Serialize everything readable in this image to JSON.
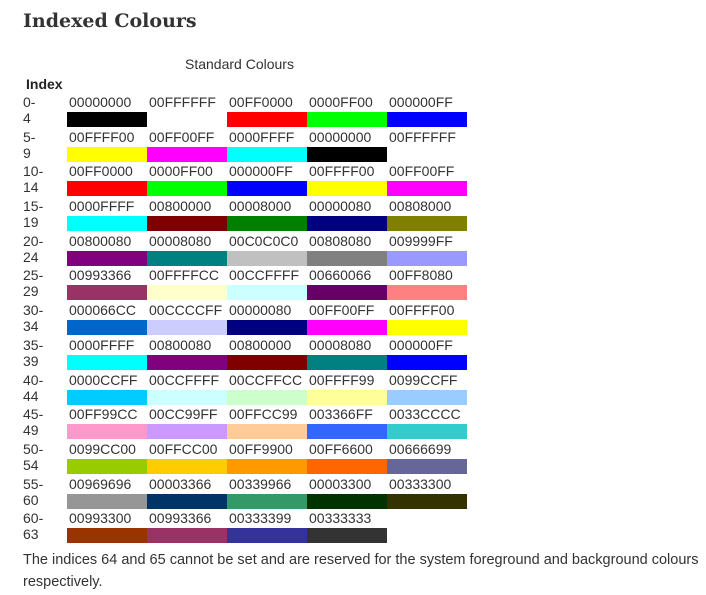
{
  "title": "Indexed Colours",
  "caption": "Standard Colours",
  "index_header": "Index",
  "rows": [
    {
      "label": "0-4",
      "colors": [
        "00000000",
        "00FFFFFF",
        "00FF0000",
        "0000FF00",
        "000000FF"
      ]
    },
    {
      "label": "5-9",
      "colors": [
        "00FFFF00",
        "00FF00FF",
        "0000FFFF",
        "00000000",
        "00FFFFFF"
      ]
    },
    {
      "label": "10-14",
      "colors": [
        "00FF0000",
        "0000FF00",
        "000000FF",
        "00FFFF00",
        "00FF00FF"
      ]
    },
    {
      "label": "15-19",
      "colors": [
        "0000FFFF",
        "00800000",
        "00008000",
        "00000080",
        "00808000"
      ]
    },
    {
      "label": "20-24",
      "colors": [
        "00800080",
        "00008080",
        "00C0C0C0",
        "00808080",
        "009999FF"
      ]
    },
    {
      "label": "25-29",
      "colors": [
        "00993366",
        "00FFFFCC",
        "00CCFFFF",
        "00660066",
        "00FF8080"
      ]
    },
    {
      "label": "30-34",
      "colors": [
        "000066CC",
        "00CCCCFF",
        "00000080",
        "00FF00FF",
        "00FFFF00"
      ]
    },
    {
      "label": "35-39",
      "colors": [
        "0000FFFF",
        "00800080",
        "00800000",
        "00008080",
        "000000FF"
      ]
    },
    {
      "label": "40-44",
      "colors": [
        "0000CCFF",
        "00CCFFFF",
        "00CCFFCC",
        "00FFFF99",
        "0099CCFF"
      ]
    },
    {
      "label": "45-49",
      "colors": [
        "00FF99CC",
        "00CC99FF",
        "00FFCC99",
        "003366FF",
        "0033CCCC"
      ]
    },
    {
      "label": "50-54",
      "colors": [
        "0099CC00",
        "00FFCC00",
        "00FF9900",
        "00FF6600",
        "00666699"
      ]
    },
    {
      "label": "55-60",
      "colors": [
        "00969696",
        "00003366",
        "00339966",
        "00003300",
        "00333300"
      ]
    },
    {
      "label": "60-63",
      "colors": [
        "00993300",
        "00993366",
        "00333399",
        "00333333"
      ]
    }
  ],
  "footnote": "The indices 64 and 65 cannot be set and are reserved for the system foreground and background colours respectively."
}
